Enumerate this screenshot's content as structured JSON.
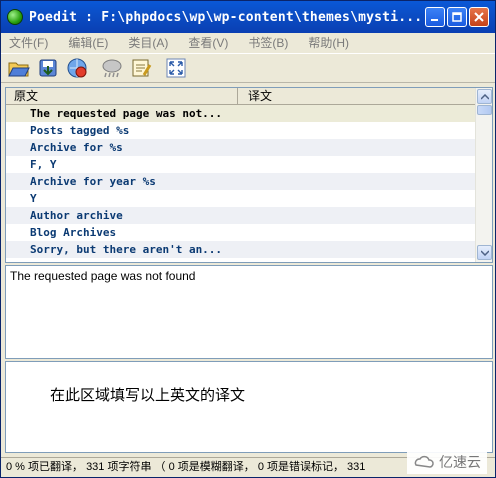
{
  "window": {
    "title": "Poedit : F:\\phpdocs\\wp\\wp-content\\themes\\mysti...",
    "controls": [
      "minimize",
      "maximize",
      "close"
    ]
  },
  "menu": [
    {
      "label": "文件(F)"
    },
    {
      "label": "编辑(E)"
    },
    {
      "label": "类目(A)"
    },
    {
      "label": "查看(V)"
    },
    {
      "label": "书签(B)"
    },
    {
      "label": "帮助(H)"
    }
  ],
  "toolbar": {
    "icons": [
      "open-folder-icon",
      "save-icon",
      "update-catalog-icon",
      "fuzzy-icon",
      "comment-icon",
      "fullscreen-icon"
    ]
  },
  "list": {
    "header_original": "原文",
    "header_translation": "译文",
    "rows": [
      "The requested page was not...",
      "Posts tagged %s",
      "Archive for %s",
      "F, Y",
      "Archive for year %s",
      "Y",
      "Author archive",
      "Blog Archives",
      "Sorry, but there aren't an..."
    ]
  },
  "source_text": "The requested page was not found",
  "translation_hint": "在此区域填写以上英文的译文",
  "status": "0 % 项已翻译， 331 项字符串 （ 0 项是模糊翻译， 0 项是错误标记， 331",
  "watermark": "亿速云",
  "colors": {
    "titlebar": "#0b4ec6",
    "row_text": "#0b3a73",
    "row_alt": "#eef0f5"
  }
}
